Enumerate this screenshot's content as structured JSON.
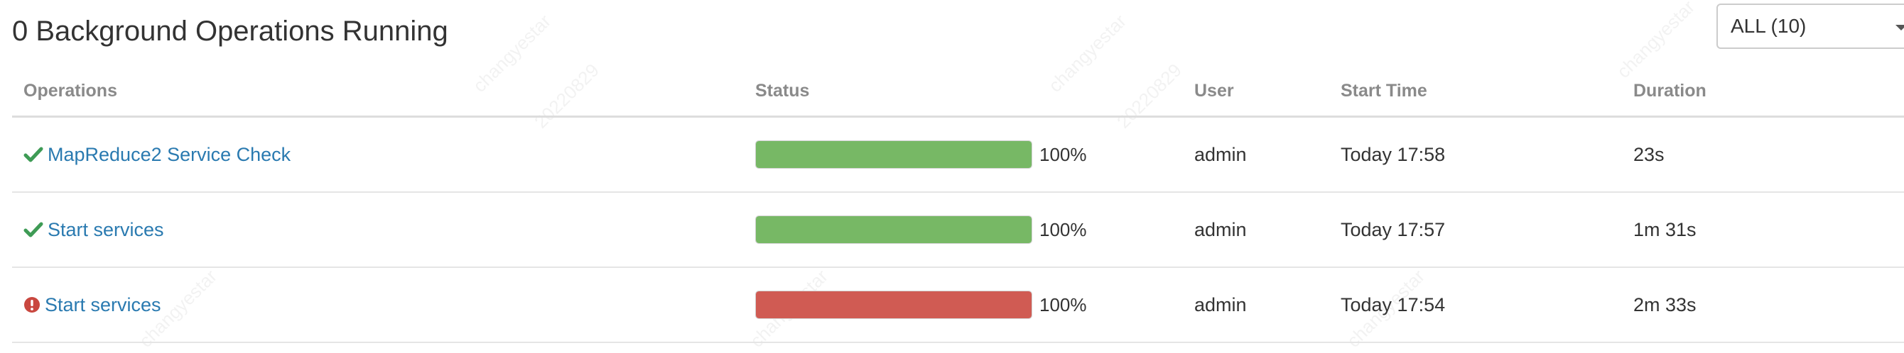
{
  "header": {
    "title": "0 Background Operations Running",
    "filter_label": "ALL (10)"
  },
  "table": {
    "columns": [
      "Operations",
      "Status",
      "User",
      "Start Time",
      "Duration"
    ],
    "rows": [
      {
        "status_icon": "check-icon",
        "operation": "MapReduce2 Service Check",
        "progress": 100,
        "progress_label": "100%",
        "progress_color": "#77b865",
        "user": "admin",
        "start_time": "Today 17:58",
        "duration": "23s"
      },
      {
        "status_icon": "check-icon",
        "operation": "Start services",
        "progress": 100,
        "progress_label": "100%",
        "progress_color": "#77b865",
        "user": "admin",
        "start_time": "Today 17:57",
        "duration": "1m 31s"
      },
      {
        "status_icon": "exclamation-circle-icon",
        "operation": "Start services",
        "progress": 100,
        "progress_label": "100%",
        "progress_color": "#d05b53",
        "user": "admin",
        "start_time": "Today 17:54",
        "duration": "2m 33s"
      }
    ]
  },
  "colors": {
    "success": "#3e9b55",
    "error": "#c9473f",
    "link": "#2a7ab0"
  }
}
